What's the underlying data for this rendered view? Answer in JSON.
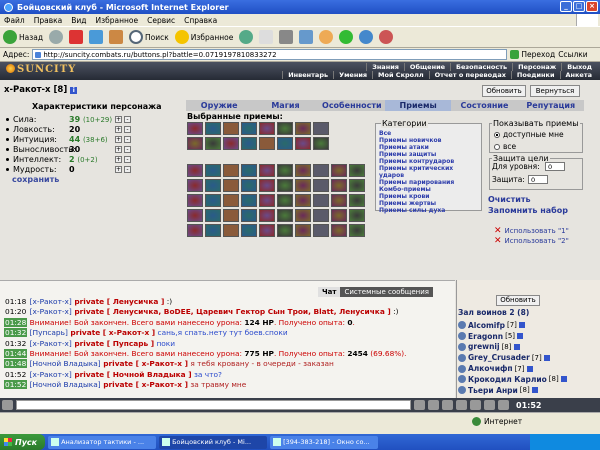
{
  "window": {
    "title": "Бойцовский клуб - Microsoft Internet Explorer"
  },
  "menu": [
    "Файл",
    "Правка",
    "Вид",
    "Избранное",
    "Сервис",
    "Справка"
  ],
  "toolbar": {
    "back": "Назад",
    "search": "Поиск",
    "favorites": "Избранное"
  },
  "address": {
    "label": "Адрес:",
    "url": "http://suncity.combats.ru/buttons.pl?battle=0.0719197810833272",
    "go": "Переход",
    "links": "Ссылки"
  },
  "site": {
    "logo": "SUNCITY",
    "nav_top": [
      "Знания",
      "Общение",
      "Безопасность",
      "Персонаж",
      "Выход"
    ],
    "nav_bottom": [
      "Инвентарь",
      "Умения",
      "Мой Скролл",
      "Отчет о переводах",
      "Поединки",
      "Анкета"
    ]
  },
  "character": {
    "name": "x-Ракот-x",
    "level": "[8]"
  },
  "buttons": {
    "refresh": "Обновить",
    "return": "Вернуться",
    "update": "Обновить"
  },
  "stats": {
    "title": "Характеристики персонажа",
    "items": [
      {
        "name": "Сила:",
        "value": "39",
        "extra": "(10+29)",
        "green": true
      },
      {
        "name": "Ловкость:",
        "value": "20",
        "extra": "",
        "green": false
      },
      {
        "name": "Интуиция:",
        "value": "44",
        "extra": "(38+6)",
        "green": true
      },
      {
        "name": "Выносливость:",
        "value": "30",
        "extra": "",
        "green": false
      },
      {
        "name": "Интеллект:",
        "value": "2",
        "extra": "(0+2)",
        "green": true
      },
      {
        "name": "Мудрость:",
        "value": "0",
        "extra": "",
        "green": false
      }
    ],
    "save": "сохранить"
  },
  "tabs": [
    {
      "label": "Оружие",
      "active": false
    },
    {
      "label": "Магия",
      "active": false
    },
    {
      "label": "Особенности",
      "active": false
    },
    {
      "label": "Приемы",
      "active": true
    },
    {
      "label": "Состояние",
      "active": false
    },
    {
      "label": "Репутация",
      "active": false
    }
  ],
  "moves": {
    "selected_title": "Выбранные приемы:"
  },
  "categories": {
    "title": "Категории",
    "items": [
      "Все",
      "Приемы новичков",
      "Приемы атаки",
      "Приемы защиты",
      "Приемы контрударов",
      "Приемы критических ударов",
      "Приемы парирования",
      "Комбо-приемы",
      "Приемы крови",
      "Приемы жертвы",
      "Приемы силы духа"
    ]
  },
  "show": {
    "title": "Показывать приемы",
    "opt1": "доступные мне",
    "opt2": "все"
  },
  "defense": {
    "title": "Защита цели",
    "for_level": "Для уровня:",
    "level_value": "0",
    "defense_label": "Защита:",
    "defense_value": "0"
  },
  "links": {
    "clear": "Очистить",
    "save_set": "Запомнить набор",
    "use1": "Использовать \"1\"",
    "use2": "Использовать \"2\""
  },
  "chat": {
    "tabs": [
      "Чат",
      "Системные сообщения"
    ],
    "lines": [
      {
        "time": "01:18",
        "green": false,
        "segs": [
          [
            "u",
            "[x-Ракот-x]"
          ],
          [
            "pv",
            " private [ Ленусичка ]"
          ],
          [
            "n",
            " :)"
          ]
        ]
      },
      {
        "time": "01:20",
        "green": false,
        "segs": [
          [
            "u",
            "[x-Ракот-x]"
          ],
          [
            "pv",
            " private [ Ленусичка, BoDEE, Царевич Гектор Сын Трои, Blatt, Ленусичка ]"
          ],
          [
            "n",
            " :)"
          ]
        ]
      },
      {
        "time": "01:28",
        "green": true,
        "segs": [
          [
            "warn",
            "Внимание! Бой закончен. Всего вами нанесено урона: "
          ],
          [
            "b",
            "124 HP"
          ],
          [
            "warn",
            ". Получено опыта: "
          ],
          [
            "b",
            "0"
          ],
          [
            "warn",
            "."
          ]
        ]
      },
      {
        "time": "01:32",
        "green": true,
        "segs": [
          [
            "u",
            "[Пупсарь]"
          ],
          [
            "pv",
            " private [ x-Ракот-x ]"
          ],
          [
            "blue",
            " сань,я спать.нету тут боев.споки"
          ]
        ]
      },
      {
        "time": "01:32",
        "green": false,
        "segs": [
          [
            "u",
            "[x-Ракот-x]"
          ],
          [
            "pv",
            " private [ Пупсарь ]"
          ],
          [
            "blue",
            " поки"
          ]
        ]
      },
      {
        "time": "01:44",
        "green": true,
        "segs": [
          [
            "warn",
            "Внимание! Бой закончен. Всего вами нанесено урона: "
          ],
          [
            "b",
            "775 HP"
          ],
          [
            "warn",
            ". Получено опыта: "
          ],
          [
            "b",
            "2454"
          ],
          [
            "warn",
            " (69.68%)."
          ]
        ]
      },
      {
        "time": "01:48",
        "green": true,
        "segs": [
          [
            "u",
            "[Ночной Владыка]"
          ],
          [
            "pv",
            " private [ x-Ракот-x ]"
          ],
          [
            "msg",
            " я тебя кровану - в очереди - заказан"
          ]
        ]
      },
      {
        "time": "01:52",
        "green": false,
        "segs": [
          [
            "u",
            "[x-Ракот-x]"
          ],
          [
            "pv",
            " private [ Ночной Владыка ]"
          ],
          [
            "blue",
            " за что?"
          ]
        ]
      },
      {
        "time": "01:52",
        "green": true,
        "segs": [
          [
            "u",
            "[Ночной Владыка]"
          ],
          [
            "pv",
            " private [ x-Ракот-x ]"
          ],
          [
            "msg",
            " за травму мне"
          ]
        ]
      }
    ]
  },
  "room": {
    "title": "Зал воинов 2 (8)"
  },
  "users": [
    {
      "name": "Alcomifp",
      "level": "[7]"
    },
    {
      "name": "Eragonn",
      "level": "[5]"
    },
    {
      "name": "grewnij",
      "level": "[8]"
    },
    {
      "name": "Grey_Crusader",
      "level": "[7]"
    },
    {
      "name": "Алкочифп",
      "level": "[7]"
    },
    {
      "name": "Крокодил Карлио",
      "level": "[8]"
    },
    {
      "name": "Тьери Анри",
      "level": "[8]"
    }
  ],
  "clock": "01:52",
  "status": {
    "text": "",
    "zone": "Интернет"
  },
  "taskbar": {
    "start": "Пуск",
    "tasks": [
      {
        "label": "Анализатор тактики - ...",
        "active": false
      },
      {
        "label": "Бойцовский клуб - Mi...",
        "active": true
      },
      {
        "label": "[394-383-218] - Окно со...",
        "active": false
      }
    ]
  },
  "colors": {
    "title_blue": "#1f4fc4",
    "link_blue": "#2a3a9a",
    "private_red": "#bb0000"
  }
}
